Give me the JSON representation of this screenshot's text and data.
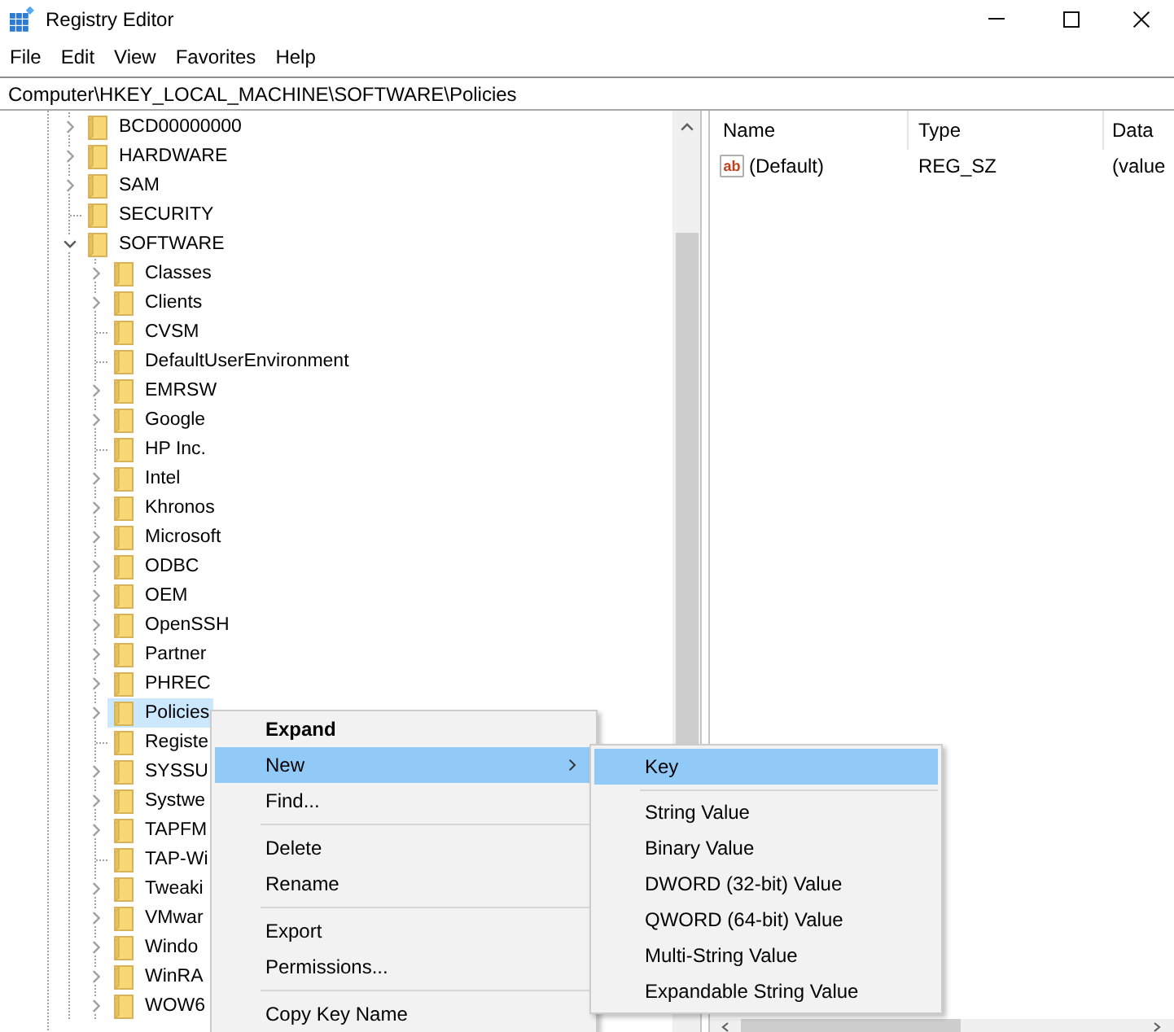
{
  "window": {
    "title": "Registry Editor"
  },
  "menu_bar": [
    "File",
    "Edit",
    "View",
    "Favorites",
    "Help"
  ],
  "address_bar": {
    "value": "Computer\\HKEY_LOCAL_MACHINE\\SOFTWARE\\Policies"
  },
  "tree": [
    {
      "label": "BCD00000000",
      "expandable": true,
      "expanded": false,
      "selected": false
    },
    {
      "label": "HARDWARE",
      "expandable": true,
      "expanded": false,
      "selected": false
    },
    {
      "label": "SAM",
      "expandable": true,
      "expanded": false,
      "selected": false
    },
    {
      "label": "SECURITY",
      "expandable": false,
      "expanded": false,
      "selected": false
    },
    {
      "label": "SOFTWARE",
      "expandable": true,
      "expanded": true,
      "selected": false,
      "children": [
        {
          "label": "Classes",
          "expandable": true,
          "expanded": false,
          "selected": false
        },
        {
          "label": "Clients",
          "expandable": true,
          "expanded": false,
          "selected": false
        },
        {
          "label": "CVSM",
          "expandable": false,
          "expanded": false,
          "selected": false
        },
        {
          "label": "DefaultUserEnvironment",
          "expandable": false,
          "expanded": false,
          "selected": false
        },
        {
          "label": "EMRSW",
          "expandable": true,
          "expanded": false,
          "selected": false
        },
        {
          "label": "Google",
          "expandable": true,
          "expanded": false,
          "selected": false
        },
        {
          "label": "HP Inc.",
          "expandable": false,
          "expanded": false,
          "selected": false
        },
        {
          "label": "Intel",
          "expandable": true,
          "expanded": false,
          "selected": false
        },
        {
          "label": "Khronos",
          "expandable": true,
          "expanded": false,
          "selected": false
        },
        {
          "label": "Microsoft",
          "expandable": true,
          "expanded": false,
          "selected": false
        },
        {
          "label": "ODBC",
          "expandable": true,
          "expanded": false,
          "selected": false
        },
        {
          "label": "OEM",
          "expandable": true,
          "expanded": false,
          "selected": false
        },
        {
          "label": "OpenSSH",
          "expandable": true,
          "expanded": false,
          "selected": false
        },
        {
          "label": "Partner",
          "expandable": true,
          "expanded": false,
          "selected": false
        },
        {
          "label": "PHREC",
          "expandable": true,
          "expanded": false,
          "selected": false
        },
        {
          "label": "Policies",
          "expandable": true,
          "expanded": false,
          "selected": true
        },
        {
          "label": "Registe",
          "expandable": false,
          "expanded": false,
          "selected": false
        },
        {
          "label": "SYSSU",
          "expandable": true,
          "expanded": false,
          "selected": false
        },
        {
          "label": "Systwe",
          "expandable": true,
          "expanded": false,
          "selected": false
        },
        {
          "label": "TAPFM",
          "expandable": true,
          "expanded": false,
          "selected": false
        },
        {
          "label": "TAP-Wi",
          "expandable": false,
          "expanded": false,
          "selected": false
        },
        {
          "label": "Tweaki",
          "expandable": true,
          "expanded": false,
          "selected": false
        },
        {
          "label": "VMwar",
          "expandable": true,
          "expanded": false,
          "selected": false
        },
        {
          "label": "Windo",
          "expandable": true,
          "expanded": false,
          "selected": false
        },
        {
          "label": "WinRA",
          "expandable": true,
          "expanded": false,
          "selected": false
        },
        {
          "label": "WOW6",
          "expandable": true,
          "expanded": false,
          "selected": false
        }
      ]
    }
  ],
  "values_pane": {
    "columns": [
      "Name",
      "Type",
      "Data"
    ],
    "rows": [
      {
        "icon_label": "ab",
        "name": "(Default)",
        "type": "REG_SZ",
        "data": "(value"
      }
    ]
  },
  "context_menu": [
    {
      "kind": "item",
      "label": "Expand",
      "default": true,
      "highlighted": false,
      "submenu": false
    },
    {
      "kind": "item",
      "label": "New",
      "default": false,
      "highlighted": true,
      "submenu": true
    },
    {
      "kind": "item",
      "label": "Find...",
      "default": false,
      "highlighted": false,
      "submenu": false
    },
    {
      "kind": "separator"
    },
    {
      "kind": "item",
      "label": "Delete",
      "default": false,
      "highlighted": false,
      "submenu": false
    },
    {
      "kind": "item",
      "label": "Rename",
      "default": false,
      "highlighted": false,
      "submenu": false
    },
    {
      "kind": "separator"
    },
    {
      "kind": "item",
      "label": "Export",
      "default": false,
      "highlighted": false,
      "submenu": false
    },
    {
      "kind": "item",
      "label": "Permissions...",
      "default": false,
      "highlighted": false,
      "submenu": false
    },
    {
      "kind": "separator"
    },
    {
      "kind": "item",
      "label": "Copy Key Name",
      "default": false,
      "highlighted": false,
      "submenu": false
    }
  ],
  "submenu": [
    {
      "kind": "item",
      "label": "Key",
      "highlighted": true
    },
    {
      "kind": "separator"
    },
    {
      "kind": "item",
      "label": "String Value",
      "highlighted": false
    },
    {
      "kind": "item",
      "label": "Binary Value",
      "highlighted": false
    },
    {
      "kind": "item",
      "label": "DWORD (32-bit) Value",
      "highlighted": false
    },
    {
      "kind": "item",
      "label": "QWORD (64-bit) Value",
      "highlighted": false
    },
    {
      "kind": "item",
      "label": "Multi-String Value",
      "highlighted": false
    },
    {
      "kind": "item",
      "label": "Expandable String Value",
      "highlighted": false
    }
  ]
}
